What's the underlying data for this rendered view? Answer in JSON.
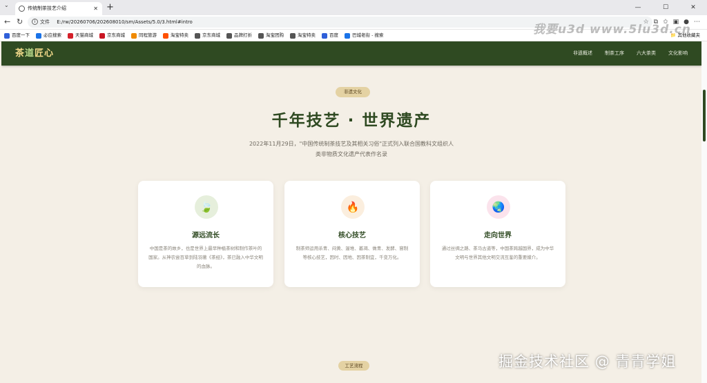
{
  "browser": {
    "tab_title": "传统制茶技艺介绍",
    "url_label": "文件",
    "url": "E:/rw/20260706/202608010/sm/Assets/5.0/3.html#intro",
    "bookmarks": [
      {
        "label": "百度一下",
        "color": "#2f5fd9"
      },
      {
        "label": "必应搜索",
        "color": "#1a73e8"
      },
      {
        "label": "天猫商城",
        "color": "#d4202a"
      },
      {
        "label": "京东商城",
        "color": "#c91623"
      },
      {
        "label": "同程旅游",
        "color": "#f08a00"
      },
      {
        "label": "淘宝特卖",
        "color": "#ff5000"
      },
      {
        "label": "京东商城",
        "color": "#555555"
      },
      {
        "label": "品牌打折",
        "color": "#555555"
      },
      {
        "label": "淘宝团购",
        "color": "#555555"
      },
      {
        "label": "淘宝特卖",
        "color": "#555555"
      },
      {
        "label": "百度",
        "color": "#2f5fd9"
      },
      {
        "label": "巴城老街 - 搜索",
        "color": "#1a73e8"
      }
    ],
    "bookmark_folder": "其他收藏夹"
  },
  "site": {
    "logo_a": "茶",
    "logo_b": "道",
    "logo_c": "匠心",
    "nav": [
      "非遗概述",
      "制茶工序",
      "六大茶类",
      "文化影响"
    ]
  },
  "intro": {
    "badge": "非遗文化",
    "title": "千年技艺 · 世界遗产",
    "desc_line1": "2022年11月29日，\"中国传统制茶技艺及其相关习俗\"正式列入联合国教科文组织人",
    "desc_line2": "类非物质文化遗产代表作名录"
  },
  "cards": [
    {
      "icon": "leaf-icon",
      "glyph": "🍃",
      "bg": "#e6efdc",
      "title": "源远流长",
      "text": "中国是茶的故乡，也是世界上最早种植茶树和制作茶叶的国家。从神农尝百草到陆羽著《茶经》，茶已融入中华文明的血脉。"
    },
    {
      "icon": "fire-icon",
      "glyph": "🔥",
      "bg": "#fbeede",
      "title": "核心技艺",
      "text": "制茶师运用杀青、闷黄、渥堆、萎凋、做青、发酵、窨制等核心技艺，因时、因地、因茶制宜，千变万化。"
    },
    {
      "icon": "globe-icon",
      "glyph": "🌏",
      "bg": "#fbe3ec",
      "title": "走向世界",
      "text": "通过丝绸之路、茶马古道等，中国茶跨越国界，成为中华文明与世界其他文明交流互鉴的重要媒介。"
    }
  ],
  "next_badge": "工艺流程",
  "watermark_top": "我要u3d www.5lu3d.cn",
  "watermark_bottom": "掘金技术社区 @ 青青学姐"
}
